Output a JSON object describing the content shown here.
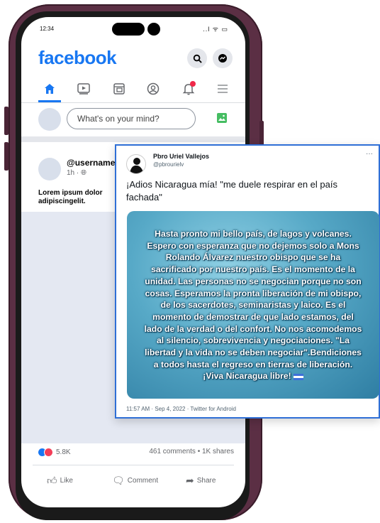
{
  "status_bar": {
    "time": "12:34",
    "icons": "..l ᯤ ▭"
  },
  "facebook": {
    "logo": "facebook",
    "search_icon": "search-icon",
    "messenger_icon": "messenger-icon",
    "tabs": [
      {
        "name": "home",
        "icon": "home-icon",
        "active": true
      },
      {
        "name": "watch",
        "icon": "video-icon",
        "active": false
      },
      {
        "name": "feeds",
        "icon": "pages-icon",
        "active": false
      },
      {
        "name": "profile",
        "icon": "profile-icon",
        "active": false
      },
      {
        "name": "notifications",
        "icon": "bell-icon",
        "active": false
      },
      {
        "name": "menu",
        "icon": "menu-icon",
        "active": false
      }
    ],
    "composer": {
      "placeholder": "What's on your mind?"
    },
    "post": {
      "username": "@username",
      "time": "1h · ",
      "text": "Lorem ipsum dolor adipiscingelit.",
      "reactions_count": "5.8K",
      "comments_shares": "461 comments  •  1K shares",
      "actions": {
        "like": "Like",
        "comment": "Comment",
        "share": "Share"
      }
    }
  },
  "tweet": {
    "name": "Pbro Uriel Vallejos",
    "handle": "@pbrourielv",
    "more": "···",
    "text": "¡Adios Nicaragua mía! \"me duele respirar en el país fachada\"",
    "image_text_lines": [
      "Hasta pronto mi bello país, de lagos y volcanes.",
      "Espero con esperanza que no dejemos solo a Mons",
      "Rolando Álvarez nuestro  obispo que se ha",
      "sacrificado por nuestro país. Es el momento de la",
      "unidad. Las personas no se negocian porque no son",
      "cosas. Esperamos la pronta liberación de mi obispo,",
      "de los sacerdotes, seminaristas y laico. Es el",
      "momento de demostrar de que lado estamos, del",
      "lado de la verdad o del confort. No nos acomodemos",
      "al silencio, sobrevivencia y negociaciones.  \"La",
      "libertad y la vida no se deben negociar\".Bendiciones",
      "a todos hasta el regreso en tierras de liberación.",
      "¡Viva Nicaragua libre!"
    ],
    "footer": "11:57 AM · Sep 4, 2022 · Twitter for Android"
  },
  "colors": {
    "facebook_blue": "#1877f2",
    "phone_frame": "#5b2f44",
    "tweet_border": "#2f6fd6"
  }
}
